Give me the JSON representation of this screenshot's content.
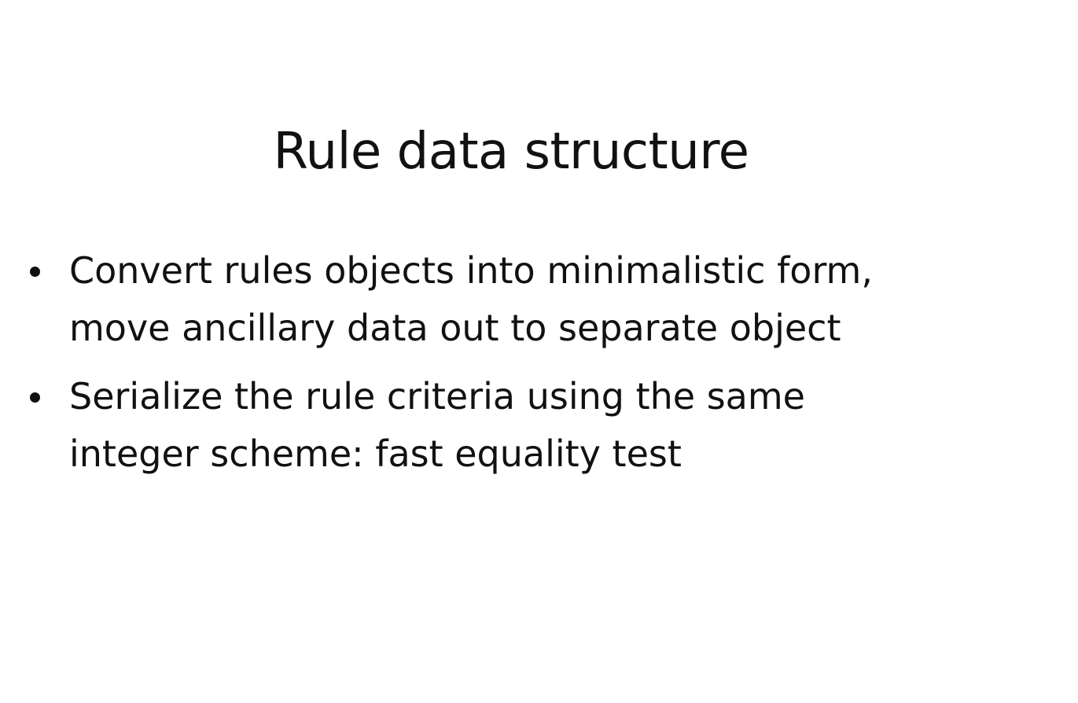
{
  "slide": {
    "title": "Rule data structure",
    "bullets": [
      {
        "lines": [
          "Convert rules objects into minimalistic form,",
          "move ancillary data out to separate object"
        ]
      },
      {
        "lines": [
          "Serialize the rule criteria using the same",
          "integer scheme: fast equality test"
        ]
      }
    ]
  }
}
